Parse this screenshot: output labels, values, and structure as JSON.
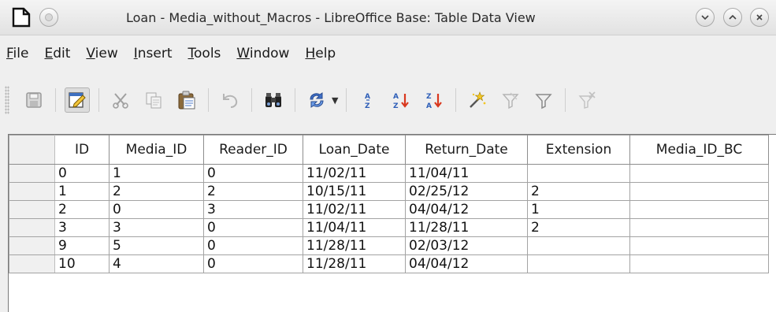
{
  "window": {
    "title": "Loan - Media_without_Macros - LibreOffice Base: Table Data View"
  },
  "menu": [
    {
      "acc": "F",
      "rest": "ile"
    },
    {
      "acc": "E",
      "rest": "dit"
    },
    {
      "acc": "V",
      "rest": "iew"
    },
    {
      "acc": "I",
      "rest": "nsert"
    },
    {
      "acc": "T",
      "rest": "ools"
    },
    {
      "acc": "W",
      "rest": "indow"
    },
    {
      "acc": "H",
      "rest": "elp"
    }
  ],
  "toolbar": {
    "icons": [
      "save-icon",
      "edit-data-icon",
      "cut-icon",
      "copy-icon",
      "paste-icon",
      "undo-icon",
      "find-icon",
      "refresh-icon",
      "sort-ascending-icon",
      "sort-ascending-az-icon",
      "sort-descending-za-icon",
      "autofilter-icon",
      "standard-filter-icon",
      "apply-filter-icon",
      "remove-filter-icon"
    ]
  },
  "table": {
    "columns": [
      "ID",
      "Media_ID",
      "Reader_ID",
      "Loan_Date",
      "Return_Date",
      "Extension",
      "Media_ID_BC"
    ],
    "rows": [
      [
        "0",
        "1",
        "0",
        "11/02/11",
        "11/04/11",
        "",
        ""
      ],
      [
        "1",
        "2",
        "2",
        "10/15/11",
        "02/25/12",
        "2",
        ""
      ],
      [
        "2",
        "0",
        "3",
        "11/02/11",
        "04/04/12",
        "1",
        ""
      ],
      [
        "3",
        "3",
        "0",
        "11/04/11",
        "11/28/11",
        "2",
        ""
      ],
      [
        "9",
        "5",
        "0",
        "11/28/11",
        "02/03/12",
        "",
        ""
      ],
      [
        "10",
        "4",
        "0",
        "11/28/11",
        "04/04/12",
        "",
        ""
      ]
    ]
  }
}
